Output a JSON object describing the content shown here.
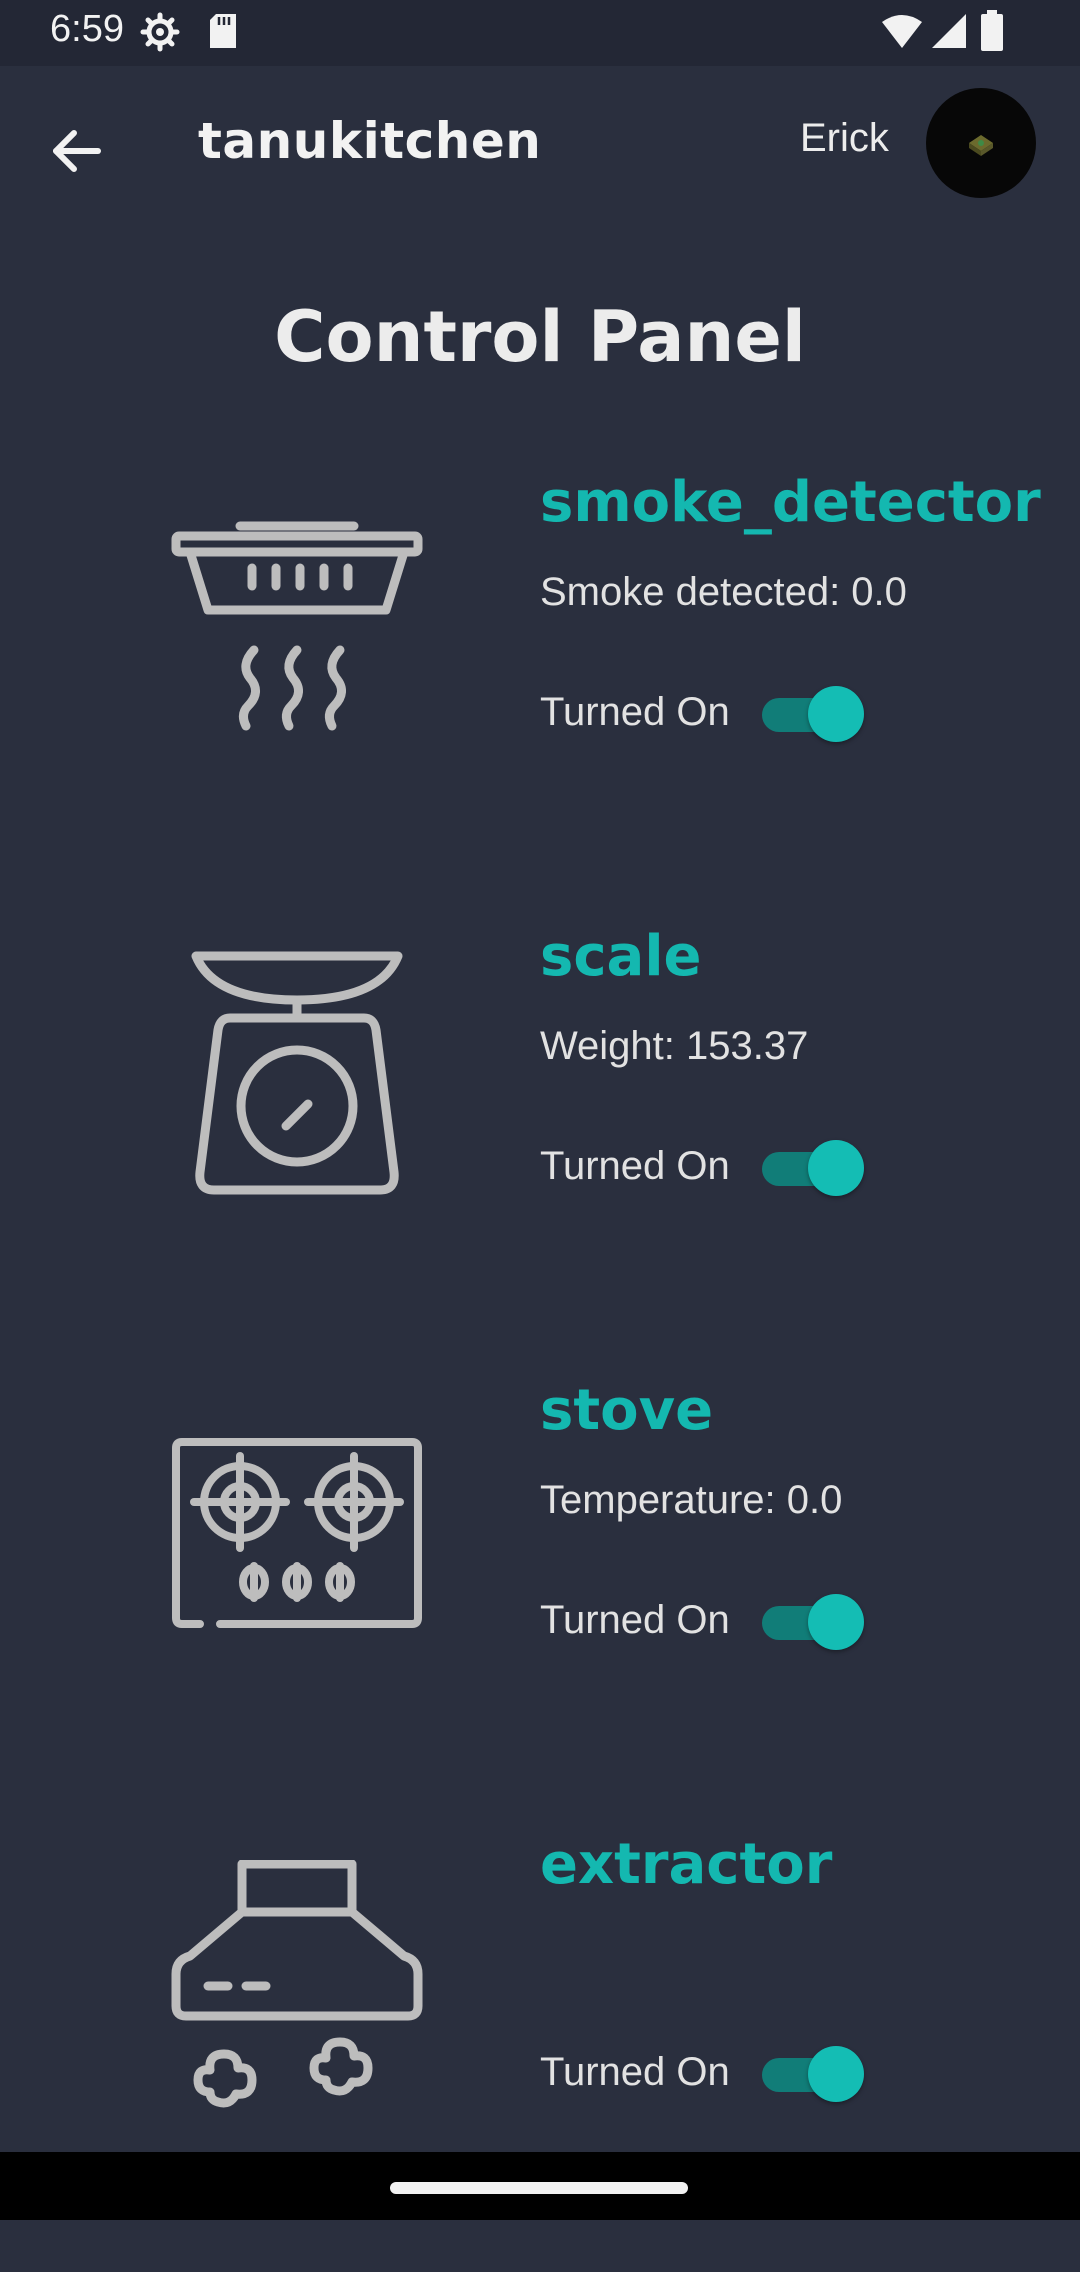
{
  "status_bar": {
    "time": "6:59",
    "icons": [
      "settings-icon",
      "sd-card-icon",
      "wifi-icon",
      "signal-icon",
      "battery-icon"
    ]
  },
  "app_bar": {
    "back_icon": "arrow-left-icon",
    "brand": "tanukitchen",
    "user_name": "Erick"
  },
  "page": {
    "title": "Control Panel"
  },
  "devices": [
    {
      "name": "smoke_detector",
      "reading": "Smoke detected: 0.0",
      "toggle_label": "Turned On",
      "toggle_on": true,
      "icon": "smoke-detector-icon"
    },
    {
      "name": "scale",
      "reading": "Weight: 153.37",
      "toggle_label": "Turned On",
      "toggle_on": true,
      "icon": "scale-icon"
    },
    {
      "name": "stove",
      "reading": "Temperature: 0.0",
      "toggle_label": "Turned On",
      "toggle_on": true,
      "icon": "stove-icon"
    },
    {
      "name": "extractor",
      "reading": "",
      "toggle_label": "Turned On",
      "toggle_on": true,
      "icon": "extractor-hood-icon"
    }
  ],
  "colors": {
    "background": "#2a2f3e",
    "accent": "#14b8b0",
    "icon_gray": "#bdbdbd"
  }
}
